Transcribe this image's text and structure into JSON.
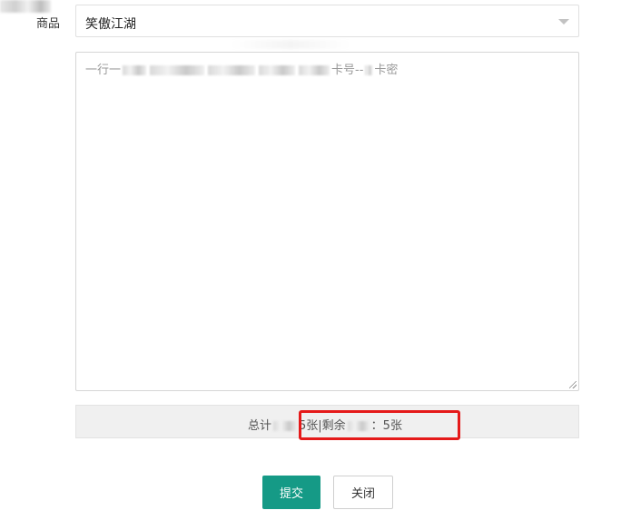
{
  "form": {
    "product_label": "商品",
    "product_value": "笑傲江湖",
    "cards_placeholder_start": "一行一",
    "cards_placeholder_mid": "卡号--",
    "cards_placeholder_end": "卡密"
  },
  "summary": {
    "text_start": "总计",
    "text_total": "5张|剩余",
    "text_remaining": "：5张"
  },
  "actions": {
    "submit_label": "提交",
    "close_label": "关闭"
  },
  "colors": {
    "primary": "#159a86",
    "highlight": "#e51a1a"
  }
}
